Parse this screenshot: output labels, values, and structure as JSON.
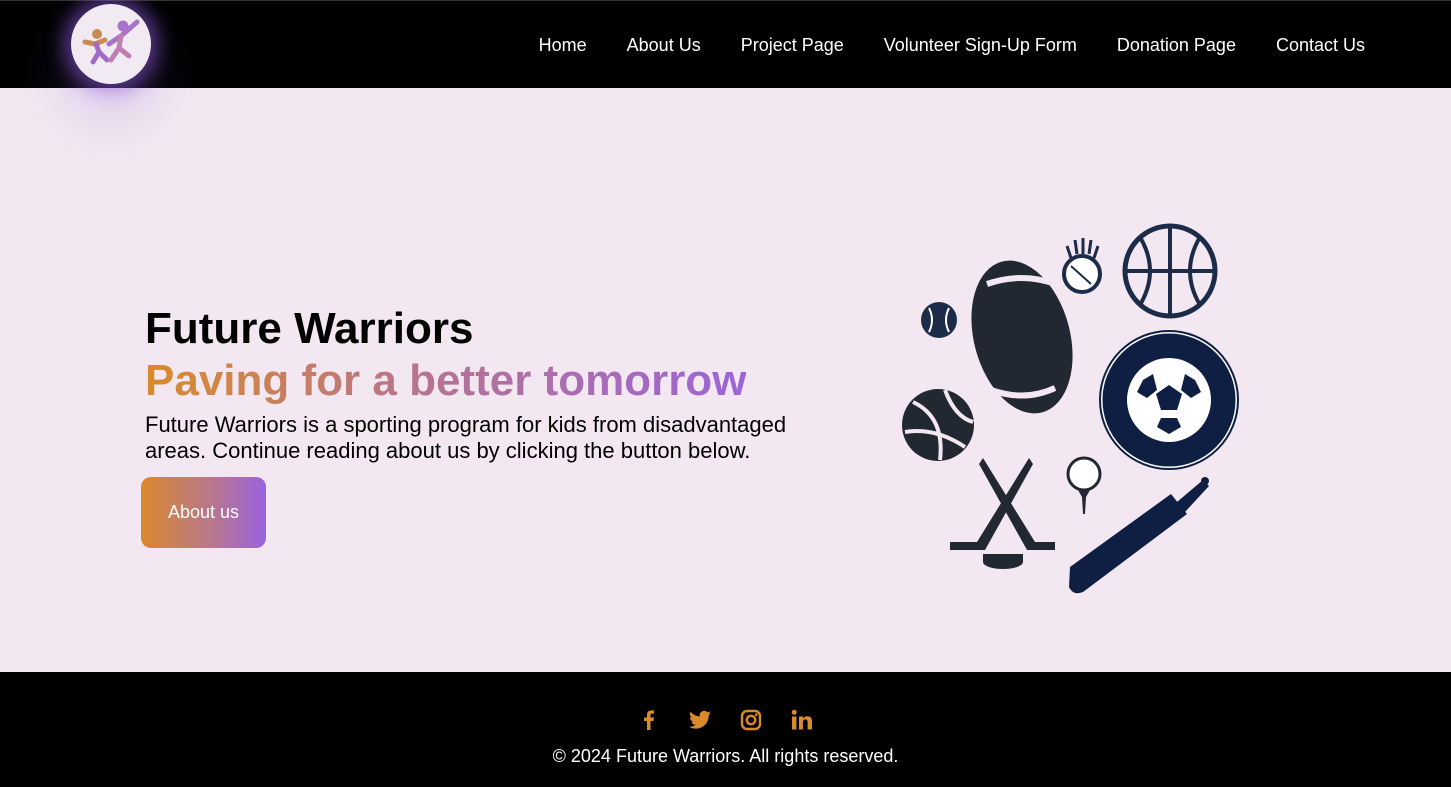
{
  "header": {
    "logo_icon": "kids-jumping-logo-icon",
    "nav": [
      {
        "label": "Home"
      },
      {
        "label": "About Us"
      },
      {
        "label": "Project Page"
      },
      {
        "label": "Volunteer Sign-Up Form"
      },
      {
        "label": "Donation Page"
      },
      {
        "label": "Contact Us"
      }
    ]
  },
  "hero": {
    "title": "Future Warriors",
    "subtitle": "Paving for a better tomorrow",
    "description": "Future Warriors is a sporting program for kids from disadvantaged areas. Continue reading about us by clicking the button below.",
    "button_label": "About us",
    "image_icon": "sports-equipment-illustration-icon"
  },
  "footer": {
    "social_icons": [
      "facebook-icon",
      "twitter-icon",
      "instagram-icon",
      "linkedin-icon"
    ],
    "copyright": "© 2024 Future Warriors. All rights reserved."
  },
  "colors": {
    "accent_orange": "#d98b2b",
    "accent_purple": "#9b65d6",
    "background": "#f3e8f1",
    "navy": "#1c2b48"
  }
}
